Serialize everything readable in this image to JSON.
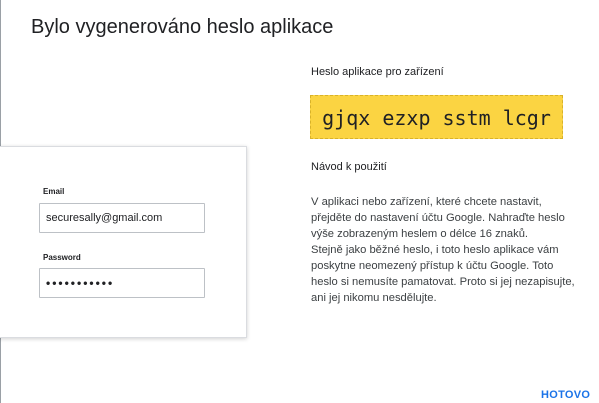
{
  "dialog": {
    "title": "Bylo vygenerováno heslo aplikace"
  },
  "example_card": {
    "email_label": "Email",
    "email_value": "securesally@gmail.com",
    "password_label": "Password",
    "password_value": "•••••••••••"
  },
  "password_section": {
    "title": "Heslo aplikace pro zařízení",
    "app_password": "gjqx ezxp sstm lcgr"
  },
  "instructions": {
    "title": "Návod k použití",
    "paragraph1": "V aplikaci nebo zařízení, které chcete nastavit, přejděte do nastavení účtu Google. Nahraďte heslo výše zobrazeným heslem o délce 16 znaků.",
    "paragraph2": "Stejně jako běžné heslo, i toto heslo aplikace vám poskytne neomezený přístup k účtu Google. Toto heslo si nemusíte pamatovat. Proto si jej nezapisujte, ani jej nikomu nesdělujte."
  },
  "actions": {
    "done_label": "HOTOVO"
  },
  "colors": {
    "accent": "#1a73e8",
    "password_highlight": "#fbd442"
  }
}
